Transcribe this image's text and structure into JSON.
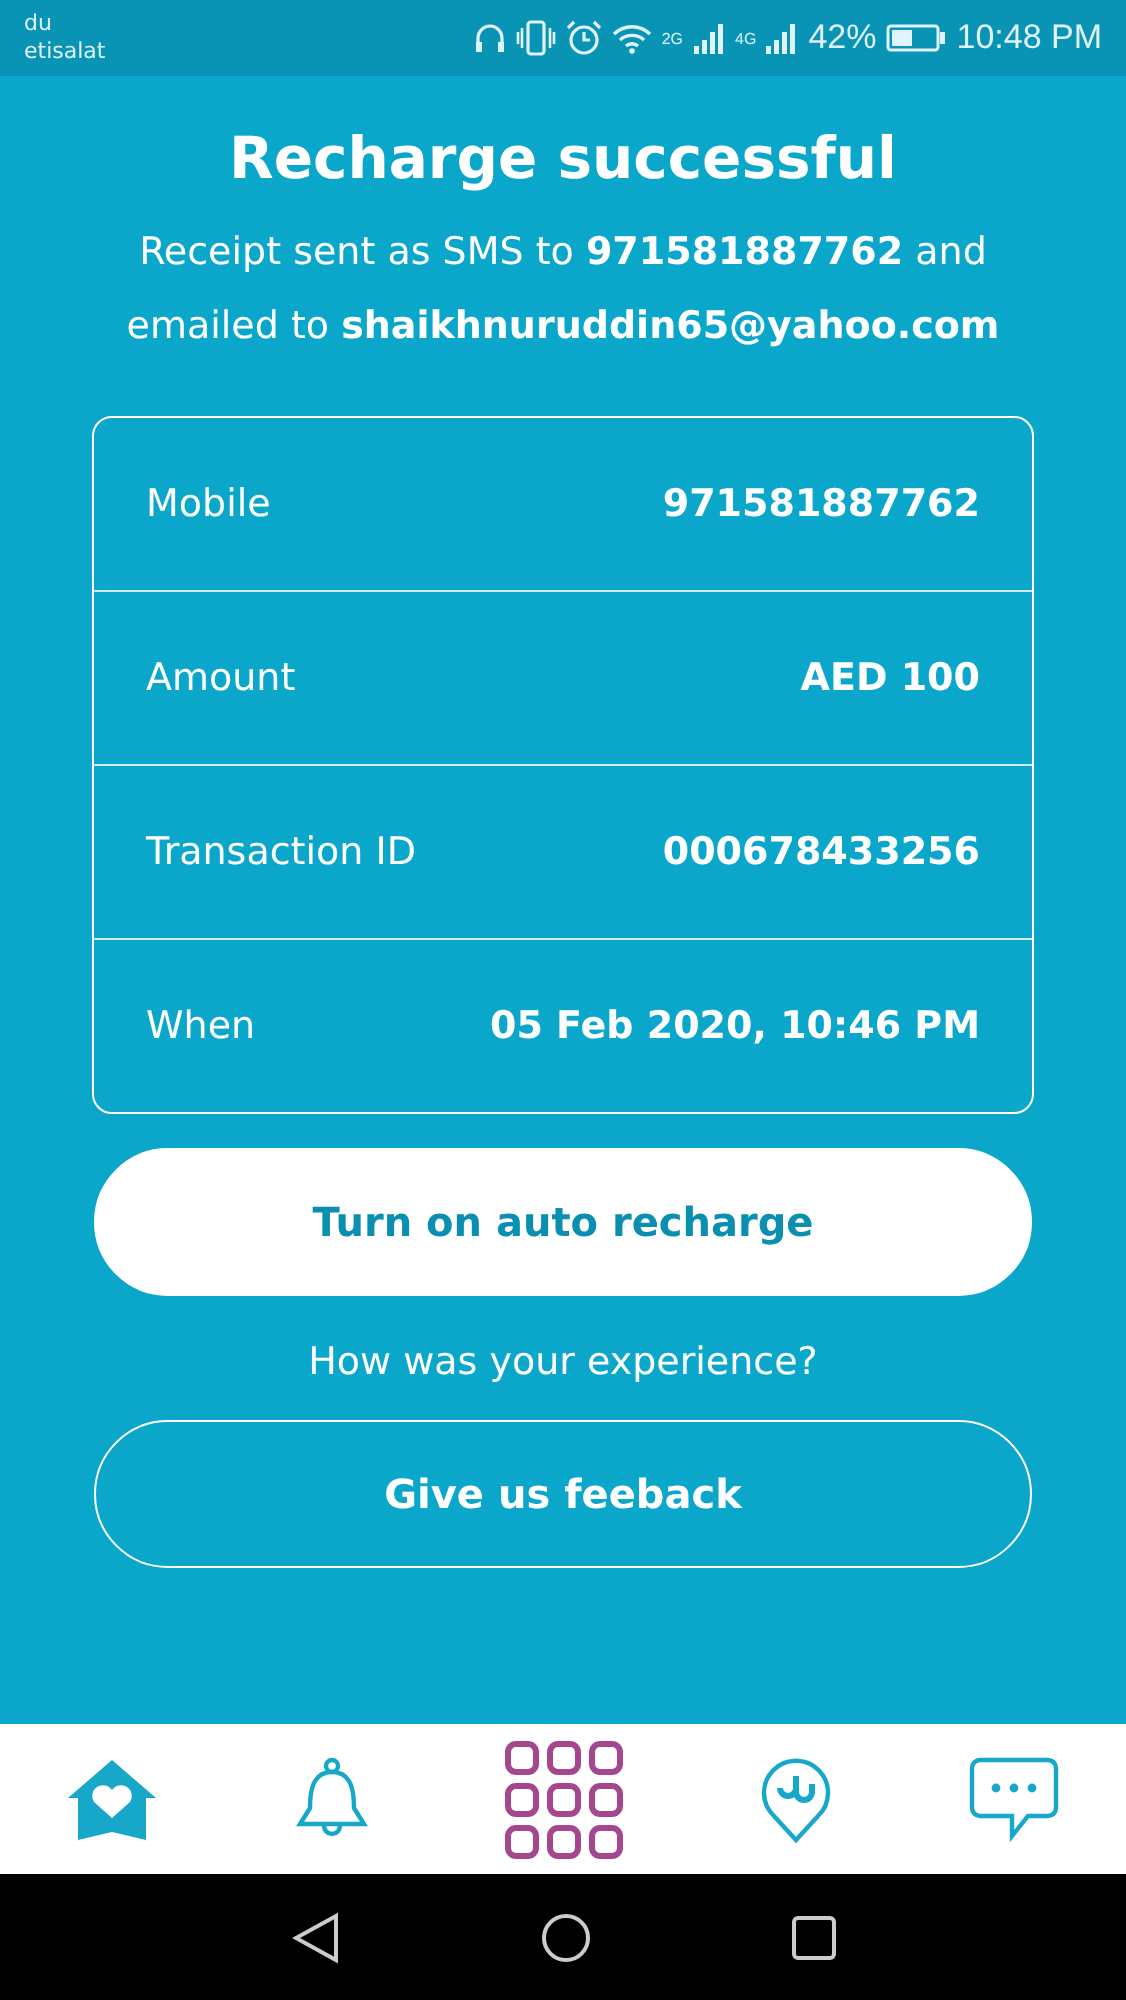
{
  "status_bar": {
    "carriers": [
      "du",
      "etisalat"
    ],
    "network_labels": [
      "2G",
      "4G"
    ],
    "battery": "42%",
    "time": "10:48 PM"
  },
  "title": "Recharge successful",
  "receipt": {
    "line_1": "Receipt sent as SMS to **971581887762** and",
    "line_2": "emailed to **shaikhnuruddin65@yahoo.com**"
  },
  "details": [
    {
      "label": "Mobile",
      "value": "971581887762"
    },
    {
      "label": "Amount",
      "value": "AED 100"
    },
    {
      "label": "Transaction ID",
      "value": "000678433256"
    },
    {
      "label": "When",
      "value": "05 Feb 2020, 10:46 PM"
    }
  ],
  "primary_button": "Turn on auto recharge",
  "question": "How was your experience?",
  "secondary_button": "Give us feeback",
  "bottom_nav": [
    {
      "kind": "home",
      "selected": false
    },
    {
      "kind": "bell",
      "selected": false
    },
    {
      "kind": "grid",
      "selected": true
    },
    {
      "kind": "pin",
      "selected": false
    },
    {
      "kind": "chat",
      "selected": false
    }
  ]
}
